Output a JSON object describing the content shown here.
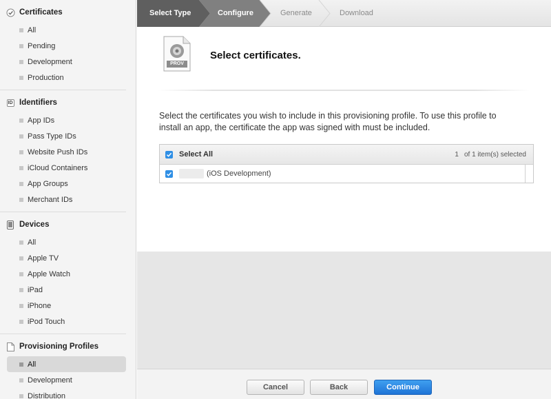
{
  "sidebar": {
    "sections": [
      {
        "title": "Certificates",
        "icon": "certificate-icon",
        "items": [
          "All",
          "Pending",
          "Development",
          "Production"
        ]
      },
      {
        "title": "Identifiers",
        "icon": "id-icon",
        "items": [
          "App IDs",
          "Pass Type IDs",
          "Website Push IDs",
          "iCloud Containers",
          "App Groups",
          "Merchant IDs"
        ]
      },
      {
        "title": "Devices",
        "icon": "device-icon",
        "items": [
          "All",
          "Apple TV",
          "Apple Watch",
          "iPad",
          "iPhone",
          "iPod Touch"
        ]
      },
      {
        "title": "Provisioning Profiles",
        "icon": "document-icon",
        "items": [
          "All",
          "Development",
          "Distribution"
        ],
        "active_index": 0
      }
    ],
    "id_badge": "ID"
  },
  "steps": [
    "Select Type",
    "Configure",
    "Generate",
    "Download"
  ],
  "main": {
    "icon_label": "PROV",
    "title": "Select certificates.",
    "description": "Select the certificates you wish to include in this provisioning profile. To use this profile to install an app, the certificate the app was signed with must be included.",
    "table": {
      "select_all": "Select All",
      "count_num": "1",
      "count_text": "of 1 item(s) selected",
      "rows": [
        {
          "label": "(iOS Development)",
          "checked": true
        }
      ]
    }
  },
  "footer": {
    "cancel": "Cancel",
    "back": "Back",
    "continue": "Continue"
  },
  "colors": {
    "accent": "#2f8fe5",
    "step_done": "#595959",
    "step_active": "#7d7d7d"
  }
}
